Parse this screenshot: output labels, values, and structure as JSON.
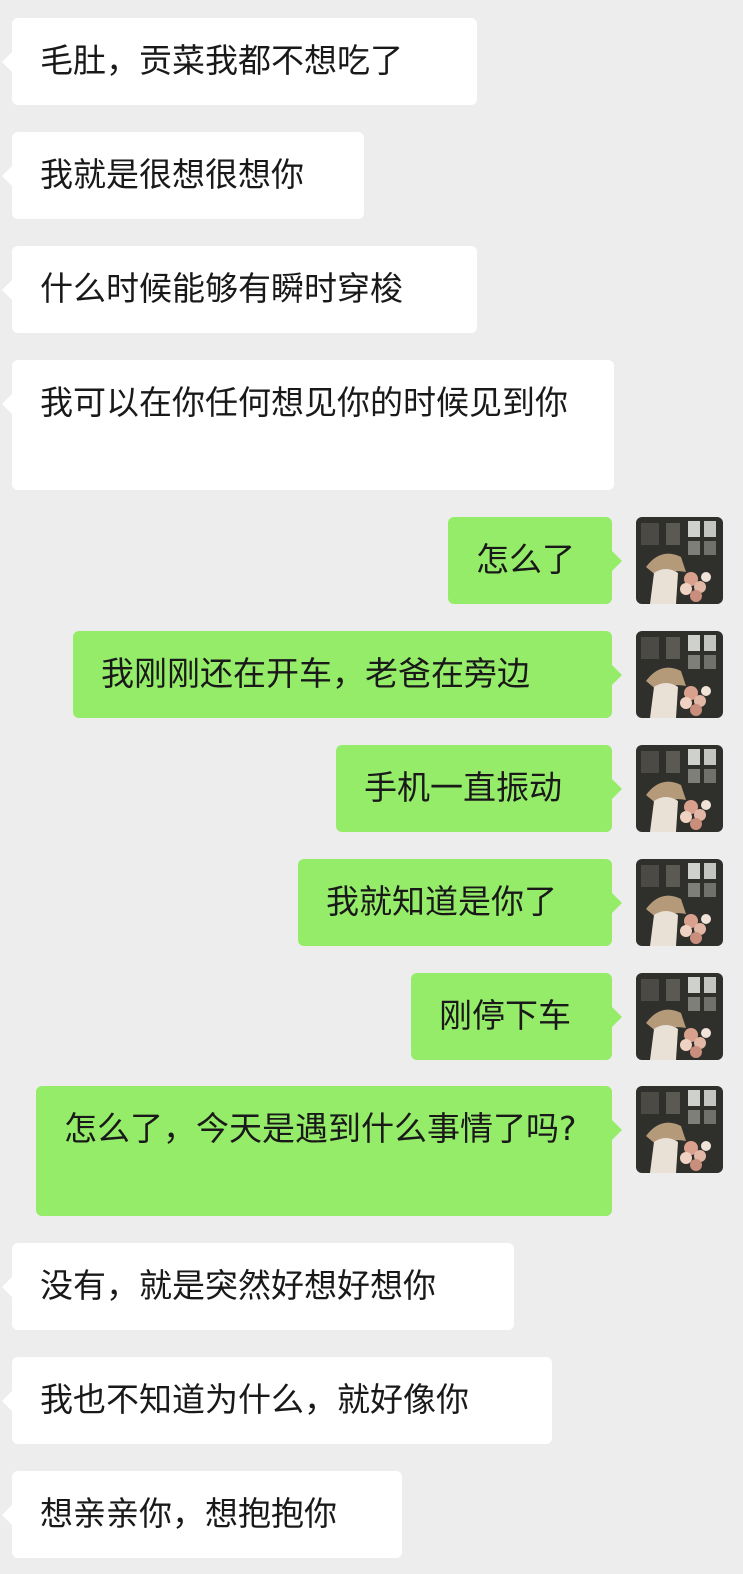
{
  "messages": [
    {
      "side": "in",
      "text": "毛肚，贡菜我都不想吃了"
    },
    {
      "side": "in",
      "text": "我就是很想很想你"
    },
    {
      "side": "in",
      "text": "什么时候能够有瞬时穿梭"
    },
    {
      "side": "in",
      "text": "我可以在你任何想见你的时候见到你"
    },
    {
      "side": "out",
      "text": "怎么了"
    },
    {
      "side": "out",
      "text": "我刚刚还在开车，老爸在旁边"
    },
    {
      "side": "out",
      "text": "手机一直振动"
    },
    {
      "side": "out",
      "text": "我就知道是你了"
    },
    {
      "side": "out",
      "text": "刚停下车"
    },
    {
      "side": "out",
      "text": "怎么了，今天是遇到什么事情了吗?"
    },
    {
      "side": "in",
      "text": "没有，就是突然好想好想你"
    },
    {
      "side": "in",
      "text": "我也不知道为什么，就好像你"
    },
    {
      "side": "in",
      "text": "想亲亲你，想抱抱你"
    }
  ],
  "colors": {
    "background": "#ededed",
    "incoming_bubble": "#ffffff",
    "outgoing_bubble": "#95ec69",
    "text": "#191919"
  },
  "icons": {
    "avatar": "user-avatar-photo"
  }
}
